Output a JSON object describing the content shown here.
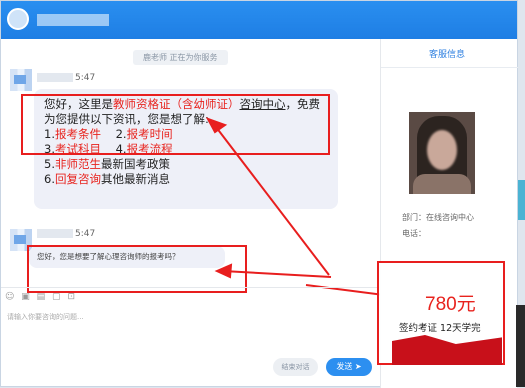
{
  "titlebar": {
    "title": "■■■ ■■"
  },
  "chat": {
    "status": "鹿老师 正在为你服务",
    "messages": [
      {
        "time": "5:47"
      },
      {
        "time": "5:47",
        "text": "您好，您是想要了解心理咨询师的报考吗？"
      }
    ],
    "welcome": {
      "intro_prefix": "您好，这里是",
      "intro_red": "教师资格证（含幼师证）",
      "intro_ul": "咨询中心",
      "intro_suffix": "，免费",
      "line2": "为您提供以下资讯，您是想了解:",
      "item1_num": "1.",
      "item1": "报考条件",
      "item2_num": "2.",
      "item2": "报考时间",
      "item3_num": "3.",
      "item3": "考试科目",
      "item4_num": "4.",
      "item4": "报考流程",
      "item5_num": "5.",
      "item5_red": "非师范生",
      "item5_rest": "最新国考政策",
      "item6_num": "6.",
      "item6_red": "回复咨询",
      "item6_rest": "其他最新消息"
    },
    "input_placeholder": "请输入你要咨询的问题...",
    "end_button": "结束对话",
    "send_button": "发送"
  },
  "sidebar": {
    "title": "客服信息",
    "name_label": "部门：在线咨询中心",
    "phone_label": "电话："
  },
  "promo": {
    "price": "780元",
    "slogan": "签约考证  12天学完"
  },
  "icons": [
    "emoji-icon",
    "image-icon",
    "file-icon",
    "screenshot-icon",
    "more-icon"
  ],
  "colors": {
    "accent": "#1e7ee4",
    "highlight": "#e81e1e"
  }
}
